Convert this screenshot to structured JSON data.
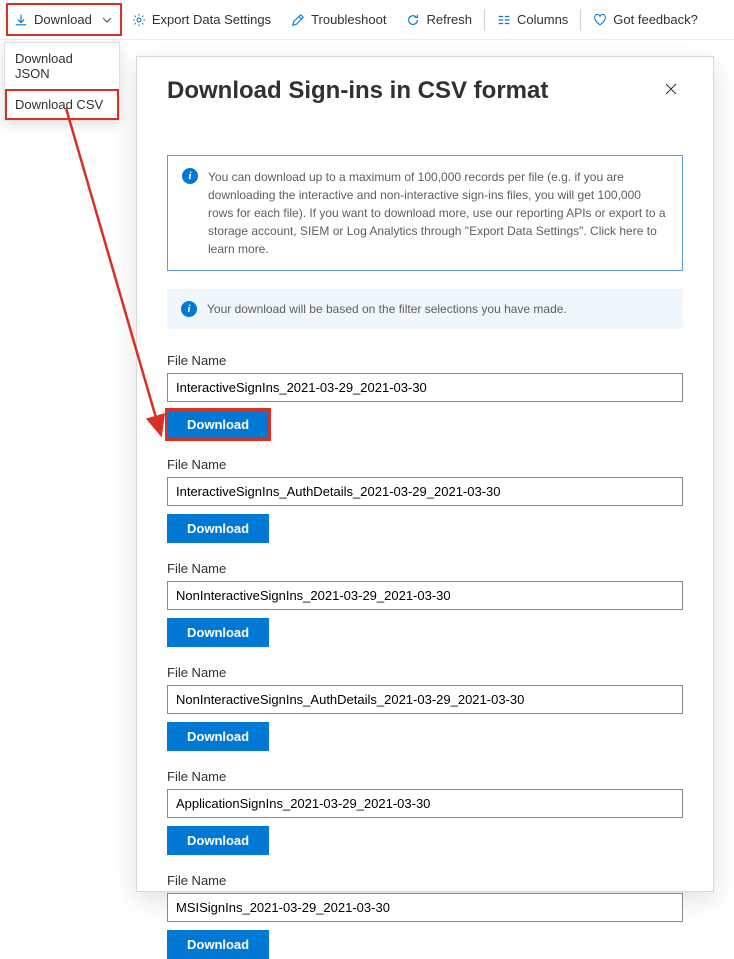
{
  "toolbar": {
    "download": "Download",
    "export": "Export Data Settings",
    "troubleshoot": "Troubleshoot",
    "refresh": "Refresh",
    "columns": "Columns",
    "feedback": "Got feedback?"
  },
  "dropdown": {
    "json": "Download JSON",
    "csv": "Download CSV"
  },
  "panel": {
    "title": "Download Sign-ins in CSV format",
    "info_msg": "You can download up to a maximum of 100,000 records per file (e.g. if you are downloading the interactive and non-interactive sign-ins files, you will get 100,000 rows for each file).  If you want to download more, use our reporting APIs or export to a storage account, SIEM or Log Analytics through \"Export Data Settings\". Click here to learn more.",
    "filter_msg": "Your download will be based on the filter selections you have made.",
    "file_label": "File Name",
    "download_btn": "Download",
    "files": [
      "InteractiveSignIns_2021-03-29_2021-03-30",
      "InteractiveSignIns_AuthDetails_2021-03-29_2021-03-30",
      "NonInteractiveSignIns_2021-03-29_2021-03-30",
      "NonInteractiveSignIns_AuthDetails_2021-03-29_2021-03-30",
      "ApplicationSignIns_2021-03-29_2021-03-30",
      "MSISignIns_2021-03-29_2021-03-30"
    ]
  }
}
